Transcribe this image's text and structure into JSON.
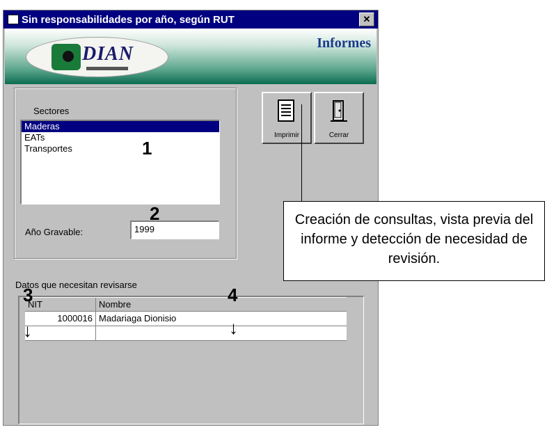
{
  "window": {
    "title": "Sin responsabilidades por año, según RUT",
    "close_label": "✕"
  },
  "banner": {
    "logo_text": "DIAN",
    "section_title": "Informes"
  },
  "sectors": {
    "label": "Sectores",
    "items": [
      "Maderas",
      "EATs",
      "Transportes"
    ],
    "selected": "Maderas"
  },
  "year": {
    "label": "Año Gravable:",
    "value": "1999"
  },
  "toolbar": {
    "print_label": "Imprimir",
    "close_label": "Cerrar"
  },
  "review": {
    "label": "Datos que necesitan revisarse",
    "columns": [
      "NIT",
      "Nombre"
    ],
    "rows": [
      {
        "nit": "1000016",
        "nombre": "Madariaga Dionisio"
      }
    ]
  },
  "annotations": {
    "n1": "1",
    "n2": "2",
    "n3": "3",
    "n4": "4",
    "callout": "Creación de consultas, vista previa del informe y detección de necesidad de revisión."
  }
}
